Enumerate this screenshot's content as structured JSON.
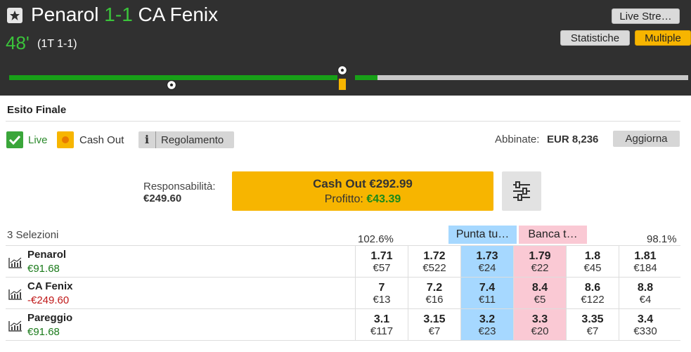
{
  "event": {
    "home": "Penarol",
    "score": "1-1",
    "away": "CA Fenix",
    "minute": "48'",
    "half_score": "(1T 1-1)"
  },
  "header_buttons": {
    "live_stream": "Live Stre…",
    "statistics": "Statistiche",
    "multiple": "Multiple"
  },
  "timeline": {
    "progress_fraction": 0.53
  },
  "market": {
    "title": "Esito Finale",
    "live_label": "Live",
    "cashout_label": "Cash Out",
    "rules_label": "Regolamento",
    "matched_label": "Abbinate:",
    "matched_value": "EUR 8,236",
    "refresh_label": "Aggiorna"
  },
  "cashout": {
    "liability_label": "Responsabilità:",
    "liability_value": "€249.60",
    "cashout_text": "Cash Out €292.99",
    "profit_label": "Profitto:",
    "profit_value": "€43.39"
  },
  "selections": {
    "count_label": "3 Selezioni",
    "back_overround": "102.6%",
    "lay_overround": "98.1%",
    "back_header": "Punta tu…",
    "lay_header": "Banca t…"
  },
  "runners": [
    {
      "name": "Penarol",
      "pl": "€91.68",
      "pl_color": "#1a7a1a",
      "odds": [
        {
          "price": "1.71",
          "size": "€57"
        },
        {
          "price": "1.72",
          "size": "€522"
        },
        {
          "price": "1.73",
          "size": "€24"
        },
        {
          "price": "1.79",
          "size": "€22"
        },
        {
          "price": "1.8",
          "size": "€45"
        },
        {
          "price": "1.81",
          "size": "€184"
        }
      ]
    },
    {
      "name": "CA Fenix",
      "pl": "-€249.60",
      "pl_color": "#c01818",
      "odds": [
        {
          "price": "7",
          "size": "€13"
        },
        {
          "price": "7.2",
          "size": "€16"
        },
        {
          "price": "7.4",
          "size": "€11"
        },
        {
          "price": "8.4",
          "size": "€5"
        },
        {
          "price": "8.6",
          "size": "€122"
        },
        {
          "price": "8.8",
          "size": "€4"
        }
      ]
    },
    {
      "name": "Pareggio",
      "pl": "€91.68",
      "pl_color": "#1a7a1a",
      "odds": [
        {
          "price": "3.1",
          "size": "€117"
        },
        {
          "price": "3.15",
          "size": "€7"
        },
        {
          "price": "3.2",
          "size": "€23"
        },
        {
          "price": "3.3",
          "size": "€20"
        },
        {
          "price": "3.35",
          "size": "€7"
        },
        {
          "price": "3.4",
          "size": "€330"
        }
      ]
    }
  ],
  "colors": {
    "header_bg": "#303030",
    "accent_green": "#3bc43b",
    "back_blue": "#a6d8ff",
    "lay_pink": "#fac9d4",
    "cashout_yellow": "#f7b500"
  },
  "icons": [
    "star-icon",
    "football-icon",
    "check-icon",
    "cashout-icon",
    "info-icon",
    "sliders-icon",
    "chart-icon"
  ]
}
